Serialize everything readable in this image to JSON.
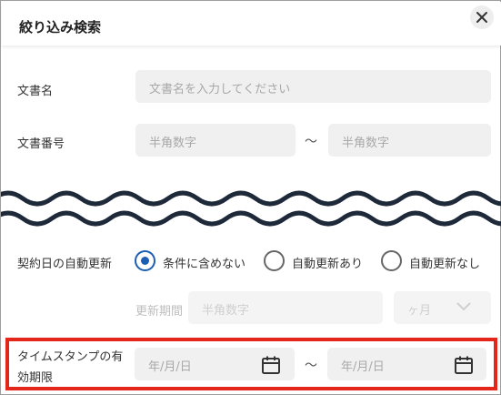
{
  "dialog": {
    "title": "絞り込み検索",
    "close_icon": "close-icon"
  },
  "document_name": {
    "label": "文書名",
    "placeholder": "文書名を入力してください"
  },
  "document_number": {
    "label": "文書番号",
    "from_placeholder": "半角数字",
    "separator": "〜",
    "to_placeholder": "半角数字"
  },
  "auto_renewal": {
    "label": "契約日の自動更新",
    "options": [
      {
        "label": "条件に含めない",
        "checked": true
      },
      {
        "label": "自動更新あり",
        "checked": false
      },
      {
        "label": "自動更新なし",
        "checked": false
      }
    ],
    "period_label": "更新期間",
    "period_placeholder": "半角数字",
    "unit_value": "ヶ月",
    "unit_icon": "chevron-down-icon"
  },
  "timestamp_validity": {
    "label_line1": "タイムスタンプの有",
    "label_line2": "効期限",
    "from_placeholder": "年/月/日",
    "separator": "〜",
    "to_placeholder": "年/月/日",
    "date_icon": "calendar-icon"
  },
  "colors": {
    "accent": "#1a5fb4",
    "highlight": "#e32619",
    "input_background": "#f0f0f0",
    "wave": "#1e2a3a"
  }
}
